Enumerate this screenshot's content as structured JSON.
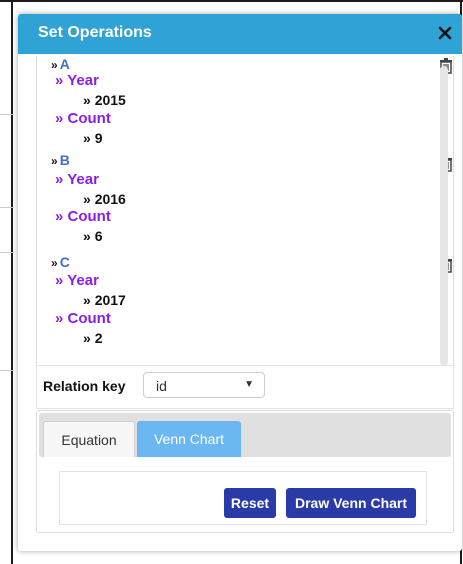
{
  "dialog": {
    "title": "Set Operations",
    "close_glyph": "✕"
  },
  "sets": [
    {
      "name": "A",
      "fields": [
        {
          "label": "Year",
          "value": "2015"
        },
        {
          "label": "Count",
          "value": "9"
        }
      ]
    },
    {
      "name": "B",
      "fields": [
        {
          "label": "Year",
          "value": "2016"
        },
        {
          "label": "Count",
          "value": "6"
        }
      ]
    },
    {
      "name": "C",
      "fields": [
        {
          "label": "Year",
          "value": "2017"
        },
        {
          "label": "Count",
          "value": "2"
        }
      ]
    }
  ],
  "chevron": "»",
  "relation": {
    "label": "Relation key",
    "selected": "id",
    "arrow": "▼"
  },
  "tabs": [
    {
      "label": "Equation",
      "active": false
    },
    {
      "label": "Venn Chart",
      "active": true
    }
  ],
  "buttons": {
    "reset": "Reset",
    "draw": "Draw Venn Chart"
  },
  "colors": {
    "titlebar": "#2fa2d6",
    "set_name": "#3f6fcc",
    "field_label": "#8a1ee6",
    "active_tab": "#6bb7f2",
    "button": "#2a3ba8"
  }
}
